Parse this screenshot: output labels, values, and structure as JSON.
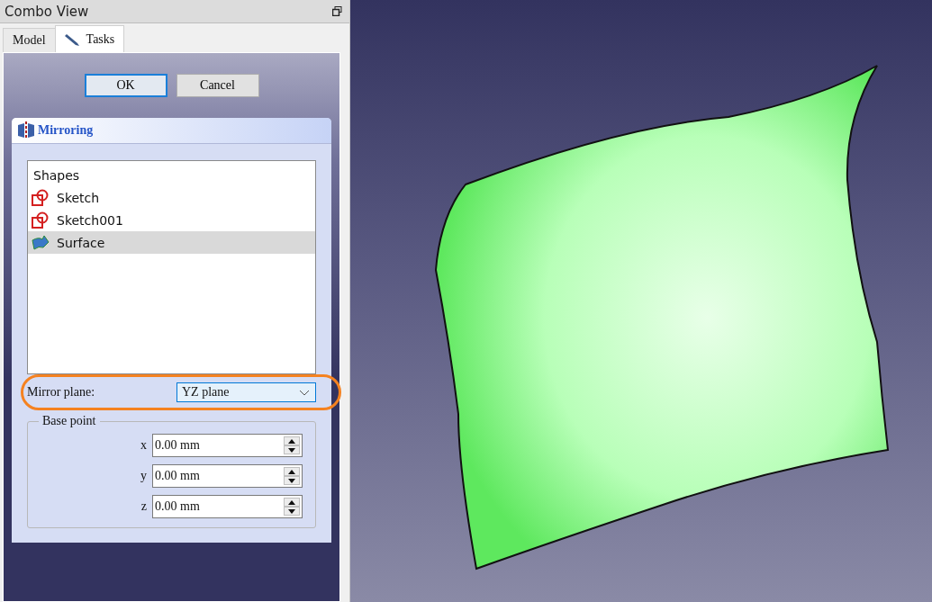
{
  "panel": {
    "title": "Combo View"
  },
  "tabs": [
    {
      "label": "Model",
      "selected": false,
      "kind": "plain"
    },
    {
      "label": "Tasks",
      "selected": true,
      "kind": "pencil"
    }
  ],
  "buttons": [
    {
      "label": "OK",
      "selected": true
    },
    {
      "label": "Cancel",
      "selected": false
    }
  ],
  "task_box": {
    "title": "Mirroring",
    "shapes": {
      "header": "Shapes",
      "items": [
        {
          "label": "Sketch",
          "kind": "sketch",
          "selected": false
        },
        {
          "label": "Sketch001",
          "kind": "sketch",
          "selected": false
        },
        {
          "label": "Surface",
          "kind": "surface",
          "selected": true
        }
      ]
    },
    "mirror_plane": {
      "label": "Mirror plane:",
      "value": "YZ plane"
    },
    "base_point": {
      "title": "Base point",
      "fields": [
        {
          "axis": "x",
          "value": "0.00 mm"
        },
        {
          "axis": "y",
          "value": "0.00 mm"
        },
        {
          "axis": "z",
          "value": "0.00 mm"
        }
      ]
    }
  }
}
